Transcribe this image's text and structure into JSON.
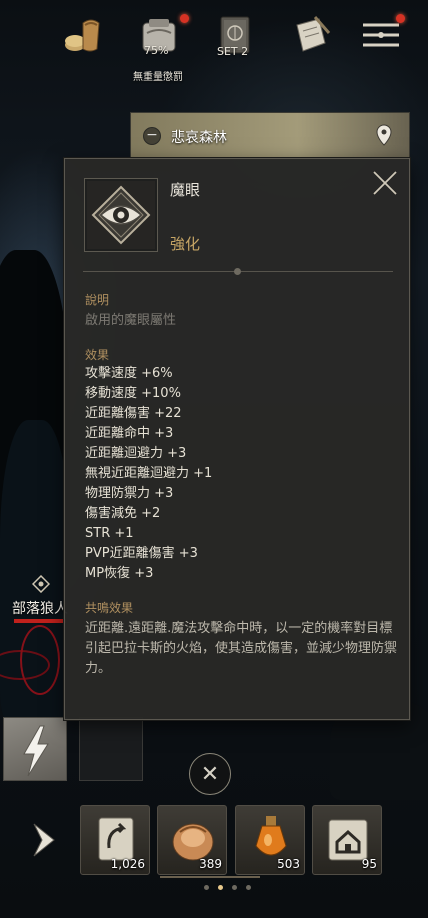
{
  "hud": {
    "icons": [
      {
        "name": "bag-icon"
      },
      {
        "name": "weight-icon",
        "percent": "75%",
        "label": "無重量懲罰"
      },
      {
        "name": "book-icon",
        "label": "SET 2"
      },
      {
        "name": "quest-scroll-icon"
      },
      {
        "name": "menu-icon"
      }
    ]
  },
  "zone": {
    "name": "悲哀森林",
    "minus": "−"
  },
  "monster": {
    "name": "部落狼人"
  },
  "tooltip": {
    "title": "魔眼",
    "grade": "強化",
    "desc_title": "說明",
    "desc_text": "啟用的魔眼屬性",
    "effects_title": "效果",
    "effects": [
      "攻擊速度 +6%",
      "移動速度 +10%",
      "近距離傷害 +22",
      "近距離命中 +3",
      "近距離迴避力 +3",
      "無視近距離迴避力 +1",
      "物理防禦力 +3",
      "傷害減免 +2",
      "STR +1",
      "PVP近距離傷害 +3",
      "MP恢復 +3"
    ],
    "resonance_title": "共鳴效果",
    "resonance_text": "近距離.遠距離.魔法攻擊命中時，以一定的機率對目標引起巴拉卡斯的火焰，使其造成傷害，並減少物理防禦力。"
  },
  "bottom": {
    "close_symbol": "✕",
    "items": [
      {
        "name": "return-scroll-icon",
        "count": "1,026"
      },
      {
        "name": "potion-bag-icon",
        "count": "389"
      },
      {
        "name": "orange-potion-icon",
        "count": "503"
      },
      {
        "name": "village-scroll-icon",
        "count": "95"
      }
    ],
    "page_count": 4,
    "active_page": 2
  },
  "colors": {
    "panel_bg": "#282826",
    "grade_gold": "#c6a565",
    "section_title": "#b09060",
    "accent_red": "#d63224"
  }
}
